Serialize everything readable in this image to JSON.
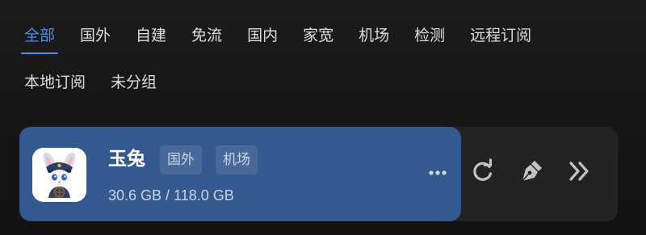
{
  "tabs": [
    {
      "label": "全部",
      "active": true
    },
    {
      "label": "国外",
      "active": false
    },
    {
      "label": "自建",
      "active": false
    },
    {
      "label": "免流",
      "active": false
    },
    {
      "label": "国内",
      "active": false
    },
    {
      "label": "家宽",
      "active": false
    },
    {
      "label": "机场",
      "active": false
    },
    {
      "label": "检测",
      "active": false
    },
    {
      "label": "远程订阅",
      "active": false
    },
    {
      "label": "本地订阅",
      "active": false
    },
    {
      "label": "未分组",
      "active": false
    }
  ],
  "subscription": {
    "name": "玉兔",
    "tags": [
      "国外",
      "机场"
    ],
    "usage": "30.6 GB / 118.0 GB",
    "icons": {
      "logo": "rabbit-logo-icon",
      "more": "more-icon",
      "refresh": "refresh-icon",
      "edit": "pen-icon",
      "next": "double-chevron-right-icon"
    }
  },
  "colors": {
    "background": "#161617",
    "accent": "#4a8fe8",
    "card_primary": "#34598f",
    "card_secondary": "#232324",
    "icon": "#c2c2c2"
  }
}
